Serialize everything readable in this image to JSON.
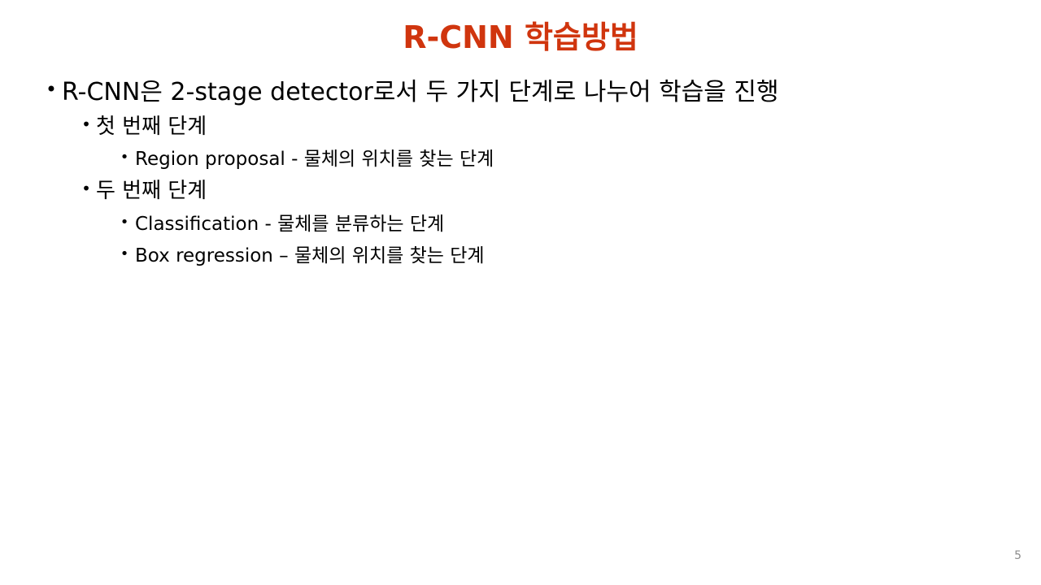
{
  "slide": {
    "title": "R-CNN 학습방법",
    "title_color": "#D0350E",
    "bullet_char": "•",
    "bullets": {
      "main": "R-CNN은 2-stage detector로서 두 가지 단계로 나누어 학습을 진행",
      "first_stage": "첫 번째 단계",
      "first_stage_detail": "Region proposal - 물체의 위치를 찾는 단계",
      "second_stage": "두 번째 단계",
      "second_stage_detail_1": "Classification - 물체를 분류하는 단계",
      "second_stage_detail_2": "Box regression – 물체의 위치를 찾는 단계"
    },
    "page_number": "5"
  }
}
